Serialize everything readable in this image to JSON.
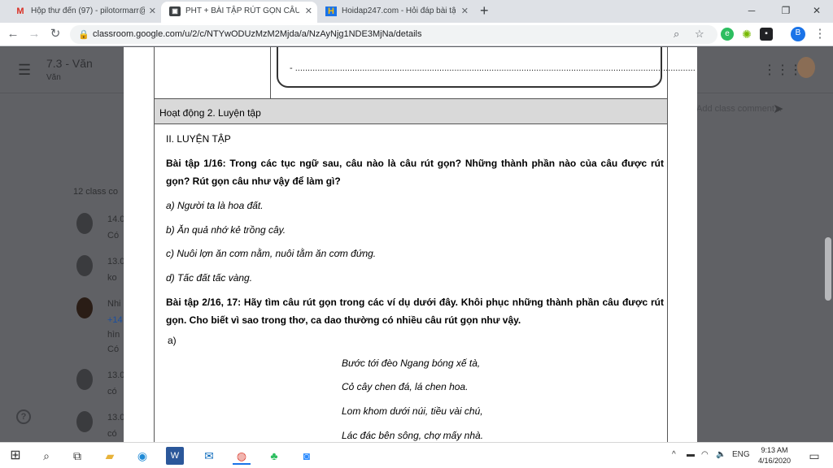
{
  "browser": {
    "tabs": [
      {
        "label": "Hộp thư đến (97) - pilotormarr@",
        "icon": "gmail-icon",
        "active": false
      },
      {
        "label": "PHT + BÀI TẬP RÚT GỌN CÂU",
        "icon": "classroom-icon",
        "active": true
      },
      {
        "label": "Hoidap247.com - Hỏi đáp bài tập",
        "icon": "hoidap-icon",
        "active": false
      }
    ],
    "new_tab_glyph": "+",
    "url": "classroom.google.com/u/2/c/NTYwODUzMzM2Mjda/a/NzAyNjg1NDE3MjNa/details",
    "window_controls": [
      "─",
      "❐",
      "✕"
    ]
  },
  "classroom": {
    "title": "7.3 - Văn",
    "subtitle": "Văn",
    "class_comments_label": "12 class co",
    "add_comment_placeholder": "Add class comment...",
    "comments": [
      {
        "line1": "14.0",
        "line2": "Có"
      },
      {
        "line1": "13.0",
        "line2": "ko"
      },
      {
        "line1": "Nhi",
        "line2": "+14",
        "line3": "hìn",
        "line4": "Có"
      },
      {
        "line1": "13.0",
        "line2": "có"
      },
      {
        "line1": "13.0",
        "line2": "có"
      }
    ]
  },
  "document": {
    "dotted_line": "- .................................................................................................................................................................",
    "activity_heading": "Hoạt động 2. Luyện tập",
    "section_title": "II. LUYỆN TẬP",
    "ex1_question": "Bài tập 1/16: Trong các tục ngữ sau, câu nào là câu rút gọn? Những thành phần nào của câu được rút gọn? Rút gọn câu như vậy để làm gì?",
    "ex1_items": [
      "a) Người ta là hoa đất.",
      "b) Ăn quả nhớ kẻ trồng cây.",
      "c) Nuôi lợn ăn cơm nằm, nuôi tằm ăn cơm đứng.",
      "d) Tấc đất tấc vàng."
    ],
    "ex2_question": "Bài tập 2/16, 17: Hãy tìm câu rút gọn trong các ví dụ dưới đây. Khôi phục những thành phần câu được rút gọn. Cho biết vì sao trong thơ, ca dao thường có nhiều câu rút gọn như vậy.",
    "ex2_label_a": "a)",
    "poem": [
      "Bước tới đèo Ngang bóng xế tà,",
      "Cỏ cây chen đá, lá chen hoa.",
      "Lom khom dưới núi, tiều vài chú,",
      "Lác đác bên sông, chợ mấy nhà."
    ]
  },
  "taskbar": {
    "language": "ENG",
    "time": "9:13 AM",
    "date": "4/16/2020"
  }
}
